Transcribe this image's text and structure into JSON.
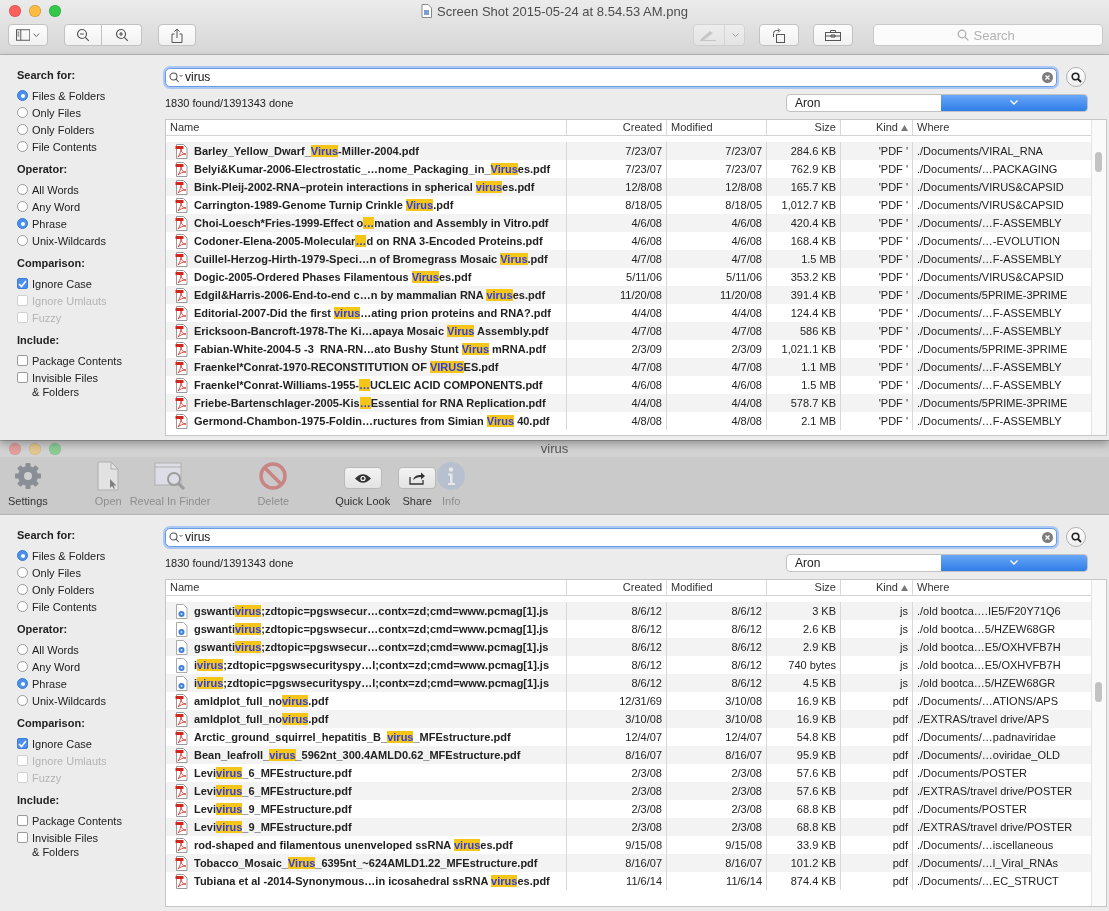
{
  "preview": {
    "title": "Screen Shot 2015-05-24 at 8.54.53 AM.png",
    "markup": {
      "disabled": true
    },
    "search_placeholder": "Search"
  },
  "top_panel": {
    "sidebar": [
      {
        "title": "Search for:",
        "options": [
          {
            "kind": "radio",
            "label": "Files & Folders",
            "selected": true
          },
          {
            "kind": "radio",
            "label": "Only Files",
            "selected": false
          },
          {
            "kind": "radio",
            "label": "Only Folders",
            "selected": false
          },
          {
            "kind": "radio",
            "label": "File Contents",
            "selected": false
          }
        ]
      },
      {
        "title": "Operator:",
        "options": [
          {
            "kind": "radio",
            "label": "All Words",
            "selected": false
          },
          {
            "kind": "radio",
            "label": "Any Word",
            "selected": false
          },
          {
            "kind": "radio",
            "label": "Phrase",
            "selected": true
          },
          {
            "kind": "radio",
            "label": "Unix-Wildcards",
            "selected": false
          }
        ]
      },
      {
        "title": "Comparison:",
        "options": [
          {
            "kind": "checkbox",
            "label": "Ignore Case",
            "checked": true,
            "disabled": false
          },
          {
            "kind": "checkbox",
            "label": "Ignore Umlauts",
            "checked": false,
            "disabled": true
          },
          {
            "kind": "checkbox",
            "label": "Fuzzy",
            "checked": false,
            "disabled": true
          }
        ]
      },
      {
        "title": "Include:",
        "options": [
          {
            "kind": "checkbox",
            "label": "Package Contents",
            "checked": false,
            "disabled": false
          },
          {
            "kind": "checkbox",
            "label": "Invisible Files\n& Folders",
            "checked": false,
            "disabled": false
          }
        ]
      }
    ],
    "query": "virus",
    "status": "1830 found/1391343 done",
    "location": "Aron",
    "columns": [
      {
        "label": "Name",
        "sorted": false
      },
      {
        "label": "Created",
        "sorted": false
      },
      {
        "label": "Modified",
        "sorted": false
      },
      {
        "label": "Size",
        "sorted": false
      },
      {
        "label": "Kind",
        "sorted": true
      },
      {
        "label": "Where",
        "sorted": false
      }
    ],
    "rows": [
      {
        "kind": "pdf",
        "name": [
          "Barley_Yellow_Dwarf_",
          "Virus",
          "-Miller-2004.pdf"
        ],
        "created": "7/23/07",
        "modified": "7/23/07",
        "size": "284.6 KB",
        "type": "'PDF '",
        "where": "./Documents/VIRAL_RNA"
      },
      {
        "kind": "pdf",
        "name": [
          "Belyi&Kumar-2006-Electrostatic_…nome_Packaging_in_",
          "Virus",
          "es.pdf"
        ],
        "created": "7/23/07",
        "modified": "7/23/07",
        "size": "762.9 KB",
        "type": "'PDF '",
        "where": "./Documents/…PACKAGING"
      },
      {
        "kind": "pdf",
        "name": [
          "Bink-Pleij-2002-RNA–protein interactions in spherical ",
          "virus",
          "es.pdf"
        ],
        "created": "12/8/08",
        "modified": "12/8/08",
        "size": "165.7 KB",
        "type": "'PDF '",
        "where": "./Documents/VIRUS&CAPSID"
      },
      {
        "kind": "pdf",
        "name": [
          "Carrington-1989-Genome Turnip Crinkle ",
          "Virus",
          ".pdf"
        ],
        "created": "8/18/05",
        "modified": "8/18/05",
        "size": "1,012.7 KB",
        "type": "'PDF '",
        "where": "./Documents/VIRUS&CAPSID"
      },
      {
        "kind": "pdf",
        "name": [
          "Choi-Loesch*Fries-1999-Effect o",
          "…",
          "mation and Assembly in Vitro.pdf"
        ],
        "created": "4/6/08",
        "modified": "4/6/08",
        "size": "420.4 KB",
        "type": "'PDF '",
        "where": "./Documents/…F-ASSEMBLY"
      },
      {
        "kind": "pdf",
        "name": [
          "Codoner-Elena-2005-Molecular",
          "…",
          "d on RNA 3-Encoded Proteins.pdf"
        ],
        "created": "4/6/08",
        "modified": "4/6/08",
        "size": "168.4 KB",
        "type": "'PDF '",
        "where": "./Documents/…-EVOLUTION"
      },
      {
        "kind": "pdf",
        "name": [
          "Cuillel-Herzog-Hirth-1979-Speci…n of Bromegrass Mosaic ",
          "Virus",
          ".pdf"
        ],
        "created": "4/7/08",
        "modified": "4/7/08",
        "size": "1.5 MB",
        "type": "'PDF '",
        "where": "./Documents/…F-ASSEMBLY"
      },
      {
        "kind": "pdf",
        "name": [
          "Dogic-2005-Ordered Phases Filamentous ",
          "Virus",
          "es.pdf"
        ],
        "created": "5/11/06",
        "modified": "5/11/06",
        "size": "353.2 KB",
        "type": "'PDF '",
        "where": "./Documents/VIRUS&CAPSID"
      },
      {
        "kind": "pdf",
        "name": [
          "Edgil&Harris-2006-End-to-end c…n by mammalian RNA ",
          "virus",
          "es.pdf"
        ],
        "created": "11/20/08",
        "modified": "11/20/08",
        "size": "391.4 KB",
        "type": "'PDF '",
        "where": "./Documents/5PRIME-3PRIME"
      },
      {
        "kind": "pdf",
        "name": [
          "Editorial-2007-Did the first ",
          "virus",
          "…ating prion proteins and RNA?.pdf"
        ],
        "created": "4/4/08",
        "modified": "4/4/08",
        "size": "124.4 KB",
        "type": "'PDF '",
        "where": "./Documents/…F-ASSEMBLY"
      },
      {
        "kind": "pdf",
        "name": [
          "Ericksoon-Bancroft-1978-The Ki…apaya Mosaic ",
          "Virus",
          " Assembly.pdf"
        ],
        "created": "4/7/08",
        "modified": "4/7/08",
        "size": "586 KB",
        "type": "'PDF '",
        "where": "./Documents/…F-ASSEMBLY"
      },
      {
        "kind": "pdf",
        "name": [
          "Fabian-White-2004-5 -3  RNA-RN…ato Bushy Stunt ",
          "Virus",
          " mRNA.pdf"
        ],
        "created": "2/3/09",
        "modified": "2/3/09",
        "size": "1,021.1 KB",
        "type": "'PDF '",
        "where": "./Documents/5PRIME-3PRIME"
      },
      {
        "kind": "pdf",
        "name": [
          "Fraenkel*Conrat-1970-RECONSTITUTION OF ",
          "VIRUS",
          "ES.pdf"
        ],
        "created": "4/7/08",
        "modified": "4/7/08",
        "size": "1.1 MB",
        "type": "'PDF '",
        "where": "./Documents/…F-ASSEMBLY"
      },
      {
        "kind": "pdf",
        "name": [
          "Fraenkel*Conrat-Williams-1955-",
          "…",
          "UCLEIC ACID COMPONENTS.pdf"
        ],
        "created": "4/6/08",
        "modified": "4/6/08",
        "size": "1.5 MB",
        "type": "'PDF '",
        "where": "./Documents/…F-ASSEMBLY"
      },
      {
        "kind": "pdf",
        "name": [
          "Friebe-Bartenschlager-2005-Kis",
          "…",
          "Essential for RNA Replication.pdf"
        ],
        "created": "4/4/08",
        "modified": "4/4/08",
        "size": "578.7 KB",
        "type": "'PDF '",
        "where": "./Documents/5PRIME-3PRIME"
      },
      {
        "kind": "pdf",
        "name": [
          "Germond-Chambon-1975-Foldin…ructures from Simian ",
          "Virus",
          " 40.pdf"
        ],
        "created": "4/8/08",
        "modified": "4/8/08",
        "size": "2.1 MB",
        "type": "'PDF '",
        "where": "./Documents/…F-ASSEMBLY"
      }
    ]
  },
  "finder_window": {
    "title": "virus",
    "toolbar": [
      {
        "kind": "gear",
        "label": "Settings",
        "disabled": false
      },
      {
        "kind": "document",
        "label": "Open",
        "disabled": true
      },
      {
        "kind": "reveal",
        "label": "Reveal In Finder",
        "disabled": true
      },
      {
        "kind": "delete",
        "label": "Delete",
        "disabled": true
      },
      {
        "kind": "eye",
        "label": "Quick Look",
        "disabled": false
      },
      {
        "kind": "share",
        "label": "Share",
        "disabled": false
      },
      {
        "kind": "info",
        "label": "Info",
        "disabled": true
      }
    ],
    "panel": {
      "sidebar": [
        {
          "title": "Search for:",
          "options": [
            {
              "kind": "radio",
              "label": "Files & Folders",
              "selected": true
            },
            {
              "kind": "radio",
              "label": "Only Files",
              "selected": false
            },
            {
              "kind": "radio",
              "label": "Only Folders",
              "selected": false
            },
            {
              "kind": "radio",
              "label": "File Contents",
              "selected": false
            }
          ]
        },
        {
          "title": "Operator:",
          "options": [
            {
              "kind": "radio",
              "label": "All Words",
              "selected": false
            },
            {
              "kind": "radio",
              "label": "Any Word",
              "selected": false
            },
            {
              "kind": "radio",
              "label": "Phrase",
              "selected": true
            },
            {
              "kind": "radio",
              "label": "Unix-Wildcards",
              "selected": false
            }
          ]
        },
        {
          "title": "Comparison:",
          "options": [
            {
              "kind": "checkbox",
              "label": "Ignore Case",
              "checked": true,
              "disabled": false
            },
            {
              "kind": "checkbox",
              "label": "Ignore Umlauts",
              "checked": false,
              "disabled": true
            },
            {
              "kind": "checkbox",
              "label": "Fuzzy",
              "checked": false,
              "disabled": true
            }
          ]
        },
        {
          "title": "Include:",
          "options": [
            {
              "kind": "checkbox",
              "label": "Package Contents",
              "checked": false,
              "disabled": false
            },
            {
              "kind": "checkbox",
              "label": "Invisible Files\n& Folders",
              "checked": false,
              "disabled": false
            }
          ]
        }
      ],
      "query": "virus",
      "status": "1830 found/1391343 done",
      "location": "Aron",
      "columns": [
        {
          "label": "Name",
          "sorted": false
        },
        {
          "label": "Created",
          "sorted": false
        },
        {
          "label": "Modified",
          "sorted": false
        },
        {
          "label": "Size",
          "sorted": false
        },
        {
          "label": "Kind",
          "sorted": true
        },
        {
          "label": "Where",
          "sorted": false
        }
      ],
      "rows": [
        {
          "kind": "script",
          "name": [
            "gswanti",
            "virus",
            ";zdtopic=pgswsecur…contx=zd;cmd=www.pcmag[1].js"
          ],
          "created": "8/6/12",
          "modified": "8/6/12",
          "size": "3 KB",
          "type": "js",
          "where": "./old bootca….IE5/F20Y71Q6"
        },
        {
          "kind": "script",
          "name": [
            "gswanti",
            "virus",
            ";zdtopic=pgswsecur…contx=zd;cmd=www.pcmag[1].js"
          ],
          "created": "8/6/12",
          "modified": "8/6/12",
          "size": "2.6 KB",
          "type": "js",
          "where": "./old bootca…5/HZEW68GR"
        },
        {
          "kind": "script",
          "name": [
            "gswanti",
            "virus",
            ";zdtopic=pgswsecur…contx=zd;cmd=www.pcmag[1].js"
          ],
          "created": "8/6/12",
          "modified": "8/6/12",
          "size": "2.9 KB",
          "type": "js",
          "where": "./old bootca…E5/OXHVFB7H"
        },
        {
          "kind": "script",
          "name": [
            "i",
            "virus",
            ";zdtopic=pgswsecurityspy…l;contx=zd;cmd=www.pcmag[1].js"
          ],
          "created": "8/6/12",
          "modified": "8/6/12",
          "size": "740 bytes",
          "type": "js",
          "where": "./old bootca…E5/OXHVFB7H"
        },
        {
          "kind": "script",
          "name": [
            "i",
            "virus",
            ";zdtopic=pgswsecurityspy…l;contx=zd;cmd=www.pcmag[1].js"
          ],
          "created": "8/6/12",
          "modified": "8/6/12",
          "size": "4.5 KB",
          "type": "js",
          "where": "./old bootca…5/HZEW68GR"
        },
        {
          "kind": "pdf",
          "name": [
            "amldplot_full_no",
            "virus",
            ".pdf"
          ],
          "created": "12/31/69",
          "modified": "3/10/08",
          "size": "16.9 KB",
          "type": "pdf",
          "where": "./Documents/…ATIONS/APS"
        },
        {
          "kind": "pdf",
          "name": [
            "amldplot_full_no",
            "virus",
            ".pdf"
          ],
          "created": "3/10/08",
          "modified": "3/10/08",
          "size": "16.9 KB",
          "type": "pdf",
          "where": "./EXTRAS/travel drive/APS"
        },
        {
          "kind": "pdf",
          "name": [
            "Arctic_ground_squirrel_hepatitis_B_",
            "virus",
            "_MFEstructure.pdf"
          ],
          "created": "12/4/07",
          "modified": "12/4/07",
          "size": "54.8 KB",
          "type": "pdf",
          "where": "./Documents/…padnaviridae"
        },
        {
          "kind": "pdf",
          "name": [
            "Bean_leafroll_",
            "virus",
            "_5962nt_300.4AMLD0.62_MFEstructure.pdf"
          ],
          "created": "8/16/07",
          "modified": "8/16/07",
          "size": "95.9 KB",
          "type": "pdf",
          "where": "./Documents/…oviridae_OLD"
        },
        {
          "kind": "pdf",
          "name": [
            "Levi",
            "virus",
            "_6_MFEstructure.pdf"
          ],
          "created": "2/3/08",
          "modified": "2/3/08",
          "size": "57.6 KB",
          "type": "pdf",
          "where": "./Documents/POSTER"
        },
        {
          "kind": "pdf",
          "name": [
            "Levi",
            "virus",
            "_6_MFEstructure.pdf"
          ],
          "created": "2/3/08",
          "modified": "2/3/08",
          "size": "57.6 KB",
          "type": "pdf",
          "where": "./EXTRAS/travel drive/POSTER"
        },
        {
          "kind": "pdf",
          "name": [
            "Levi",
            "virus",
            "_9_MFEstructure.pdf"
          ],
          "created": "2/3/08",
          "modified": "2/3/08",
          "size": "68.8 KB",
          "type": "pdf",
          "where": "./Documents/POSTER"
        },
        {
          "kind": "pdf",
          "name": [
            "Levi",
            "virus",
            "_9_MFEstructure.pdf"
          ],
          "created": "2/3/08",
          "modified": "2/3/08",
          "size": "68.8 KB",
          "type": "pdf",
          "where": "./EXTRAS/travel drive/POSTER"
        },
        {
          "kind": "pdf",
          "name": [
            "rod-shaped and filamentous unenveloped ssRNA ",
            "virus",
            "es.pdf"
          ],
          "created": "9/15/08",
          "modified": "9/15/08",
          "size": "33.9 KB",
          "type": "pdf",
          "where": "./Documents/…iscellaneous"
        },
        {
          "kind": "pdf",
          "name": [
            "Tobacco_Mosaic_",
            "Virus",
            "_6395nt_~624AMLD1.22_MFEstructure.pdf"
          ],
          "created": "8/16/07",
          "modified": "8/16/07",
          "size": "101.2 KB",
          "type": "pdf",
          "where": "./Documents/…l_Viral_RNAs"
        },
        {
          "kind": "pdf",
          "name": [
            "Tubiana et al -2014-Synonymous…in icosahedral ssRNA ",
            "virus",
            "es.pdf"
          ],
          "created": "11/6/14",
          "modified": "11/6/14",
          "size": "874.4 KB",
          "type": "pdf",
          "where": "./Documents/…EC_STRUCT"
        }
      ]
    }
  }
}
